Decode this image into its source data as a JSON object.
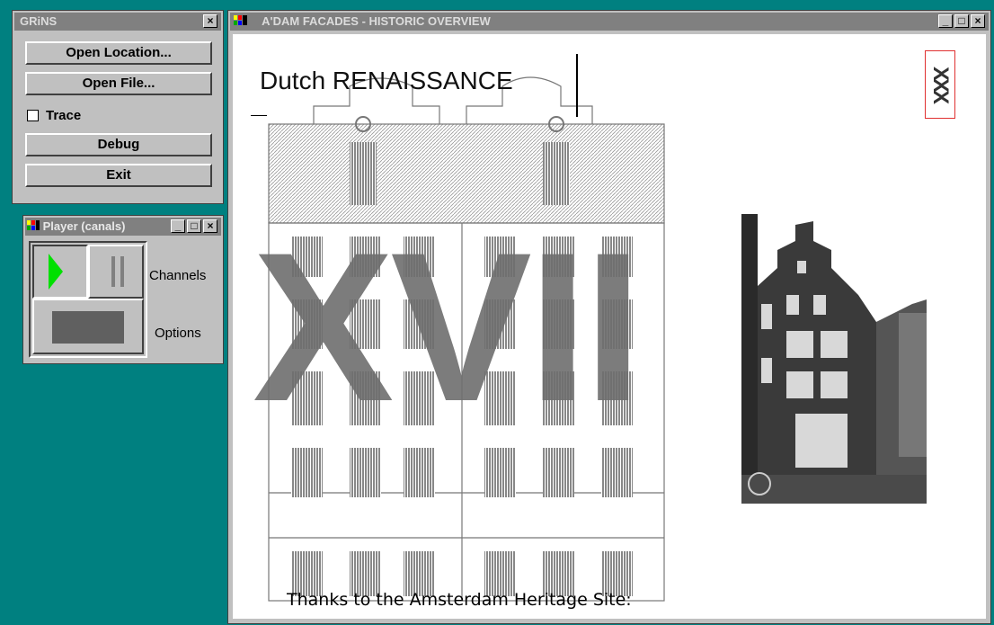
{
  "grins": {
    "title": "GRiNS",
    "open_location": "Open Location...",
    "open_file": "Open File...",
    "trace_label": "Trace",
    "trace_checked": false,
    "debug": "Debug",
    "exit": "Exit"
  },
  "player": {
    "title": "Player (canals)",
    "channels_label": "Channels",
    "options_label": "Options",
    "play_color": "#00e000"
  },
  "main": {
    "title": "A'DAM FACADES - HISTORIC OVERVIEW",
    "heading": "Dutch RENAISSANCE",
    "watermark": "XVII",
    "logo_text": "XXX",
    "caption": "Thanks to the Amsterdam Heritage Site:"
  },
  "colors": {
    "desktop": "#008080",
    "window_face": "#c0c0c0",
    "watermark": "#6e6e6e",
    "logo_border": "#e03030"
  }
}
